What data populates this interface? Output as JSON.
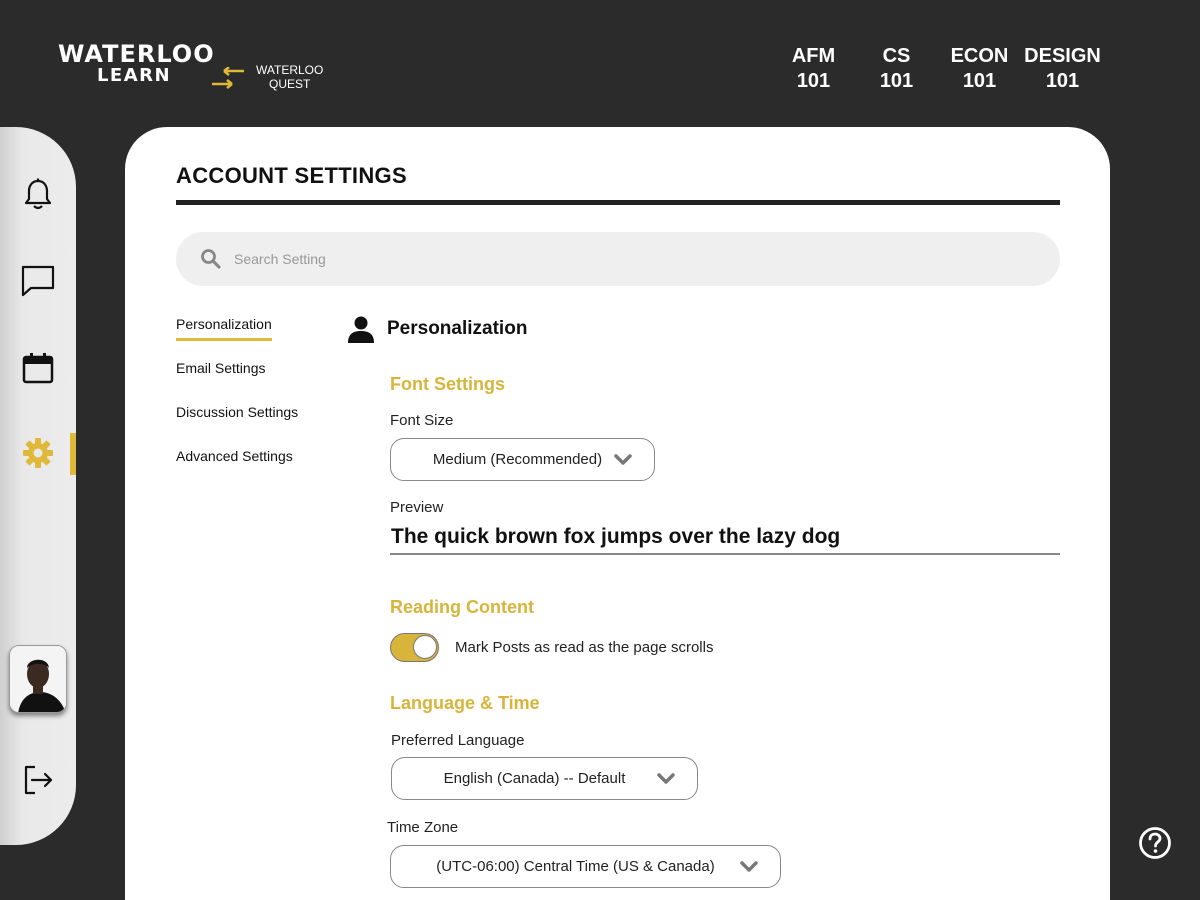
{
  "header": {
    "logo_line1": "WATERLOO",
    "logo_line2": "LEARN",
    "quest_line1": "WATERLOO",
    "quest_line2": "QUEST",
    "courses": [
      {
        "code": "AFM",
        "num": "101"
      },
      {
        "code": "CS",
        "num": "101"
      },
      {
        "code": "ECON",
        "num": "101"
      },
      {
        "code": "DESIGN",
        "num": "101"
      }
    ]
  },
  "sidebar": {
    "icons": [
      "bell-icon",
      "chat-icon",
      "calendar-icon",
      "gear-icon",
      "logout-icon"
    ],
    "active": "gear-icon"
  },
  "page": {
    "title": "ACCOUNT SETTINGS",
    "search_placeholder": "Search Setting"
  },
  "subnav": {
    "items": [
      "Personalization",
      "Email Settings",
      "Discussion Settings",
      "Advanced Settings"
    ],
    "active_index": 0
  },
  "personalization": {
    "heading": "Personalization",
    "font_settings": {
      "heading": "Font Settings",
      "font_size_label": "Font Size",
      "font_size_value": "Medium (Recommended)",
      "preview_label": "Preview",
      "preview_text": "The quick brown fox jumps over the lazy dog"
    },
    "reading_content": {
      "heading": "Reading Content",
      "toggle_label": "Mark Posts as read as the page scrolls",
      "toggle_on": true
    },
    "language_time": {
      "heading": "Language & Time",
      "language_label": "Preferred Language",
      "language_value": "English (Canada) -- Default",
      "timezone_label": "Time Zone",
      "timezone_value": "(UTC-06:00) Central Time (US & Canada)"
    }
  },
  "colors": {
    "accent": "#d9b43b",
    "background": "#2b2b2b",
    "panel": "#ffffff"
  }
}
